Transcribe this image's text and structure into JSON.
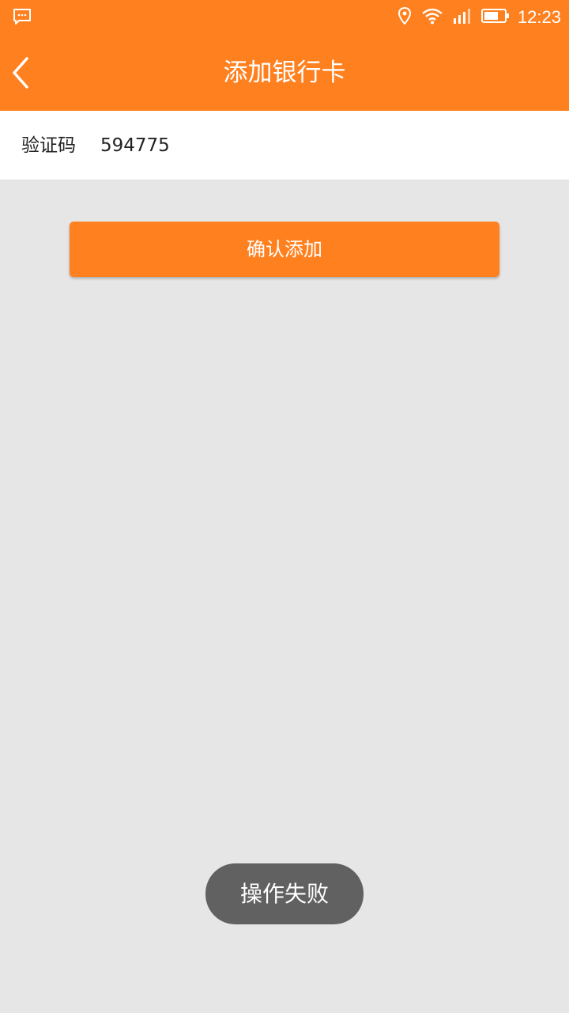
{
  "status_bar": {
    "time": "12:23",
    "icons": [
      "message-icon",
      "location-icon",
      "wifi-icon",
      "signal-icon",
      "battery-icon"
    ]
  },
  "header": {
    "title": "添加银行卡",
    "back_icon": "chevron-left-icon"
  },
  "form": {
    "code_label": "验证码",
    "code_value": "594775"
  },
  "confirm_button": {
    "label": "确认添加"
  },
  "toast": {
    "message": "操作失败"
  },
  "colors": {
    "accent": "#ff801f",
    "background": "#e6e6e6",
    "toast": "#616161"
  }
}
